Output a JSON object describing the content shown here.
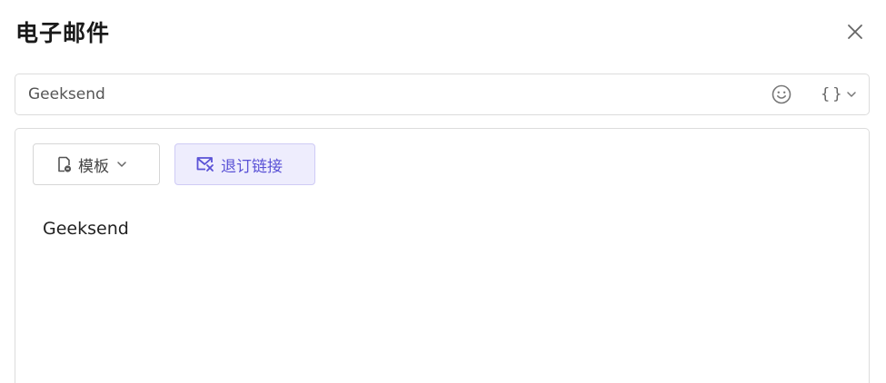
{
  "dialog": {
    "title": "电子邮件"
  },
  "subject": {
    "value": "Geeksend",
    "emoji_icon": "smile-icon",
    "variables_label": "{}",
    "variables_icon": "chevron-down-icon"
  },
  "toolbar": {
    "template_label": "模板",
    "template_icon": "template-icon",
    "unsubscribe_label": "退订链接",
    "unsubscribe_icon": "mail-unsubscribe-icon"
  },
  "editor": {
    "content": "Geeksend"
  },
  "colors": {
    "accent": "#5a52d6",
    "accent_bg": "#eeedfd",
    "border": "#dcdcdc"
  }
}
